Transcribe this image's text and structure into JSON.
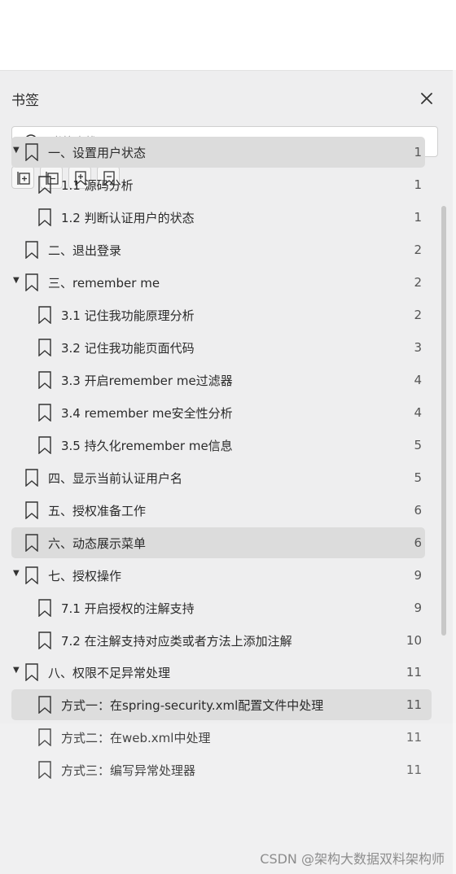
{
  "panel": {
    "title": "书签",
    "search": {
      "placeholder": "书签查找",
      "value": ""
    },
    "toolbar": [
      "expand-all-icon",
      "collapse-all-icon",
      "add-bookmark-icon",
      "remove-bookmark-icon"
    ]
  },
  "bookmarks": [
    {
      "label": "一、设置用户状态",
      "page": "1",
      "level": 0,
      "expanded": true,
      "highlight": true
    },
    {
      "label": "1.1 源码分析",
      "page": "1",
      "level": 1
    },
    {
      "label": "1.2 判断认证用户的状态",
      "page": "1",
      "level": 1
    },
    {
      "label": "二、退出登录",
      "page": "2",
      "level": 0
    },
    {
      "label": "三、remember me",
      "page": "2",
      "level": 0,
      "expanded": true
    },
    {
      "label": "3.1 记住我功能原理分析",
      "page": "2",
      "level": 1
    },
    {
      "label": "3.2 记住我功能页面代码",
      "page": "3",
      "level": 1
    },
    {
      "label": "3.3 开启remember me过滤器",
      "page": "4",
      "level": 1
    },
    {
      "label": "3.4 remember me安全性分析",
      "page": "4",
      "level": 1
    },
    {
      "label": "3.5 持久化remember me信息",
      "page": "5",
      "level": 1
    },
    {
      "label": "四、显示当前认证用户名",
      "page": "5",
      "level": 0
    },
    {
      "label": "五、授权准备工作",
      "page": "6",
      "level": 0
    },
    {
      "label": "六、动态展示菜单",
      "page": "6",
      "level": 0,
      "highlight": true
    },
    {
      "label": "七、授权操作",
      "page": "9",
      "level": 0,
      "expanded": true
    },
    {
      "label": "7.1 开启授权的注解支持",
      "page": "9",
      "level": 1
    },
    {
      "label": "7.2 在注解支持对应类或者方法上添加注解",
      "page": "10",
      "level": 1
    },
    {
      "label": "八、权限不足异常处理",
      "page": "11",
      "level": 0,
      "expanded": true
    },
    {
      "label": "方式一：在spring-security.xml配置文件中处理",
      "page": "11",
      "level": 1,
      "highlight": true
    },
    {
      "label": "方式二：在web.xml中处理",
      "page": "11",
      "level": 1
    },
    {
      "label": "方式三：编写异常处理器",
      "page": "11",
      "level": 1
    }
  ],
  "watermark": "CSDN @架构大数据双料架构师"
}
